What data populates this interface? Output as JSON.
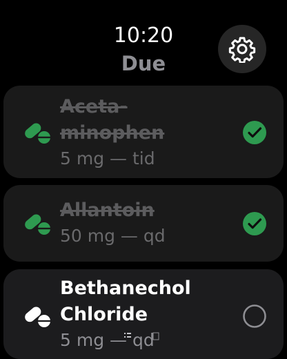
{
  "header": {
    "time": "10:20",
    "title": "Due"
  },
  "medications": [
    {
      "name": "Aceta-\nminophen",
      "dose": "5 mg — tid",
      "taken": true
    },
    {
      "name": "Allantoin",
      "dose": "50 mg — qd",
      "taken": true
    },
    {
      "name": "Bethanechol\nChloride",
      "dose": "5 mg — qd",
      "taken": false
    }
  ],
  "colors": {
    "background": "#000000",
    "card": "#1c1c1e",
    "accent_green": "#2e9a50",
    "muted_text": "#8e8e93"
  },
  "icons": {
    "settings": "gear-icon",
    "pill": "pill-icon",
    "taken": "checkmark-circle-icon",
    "pending": "empty-circle-icon"
  }
}
